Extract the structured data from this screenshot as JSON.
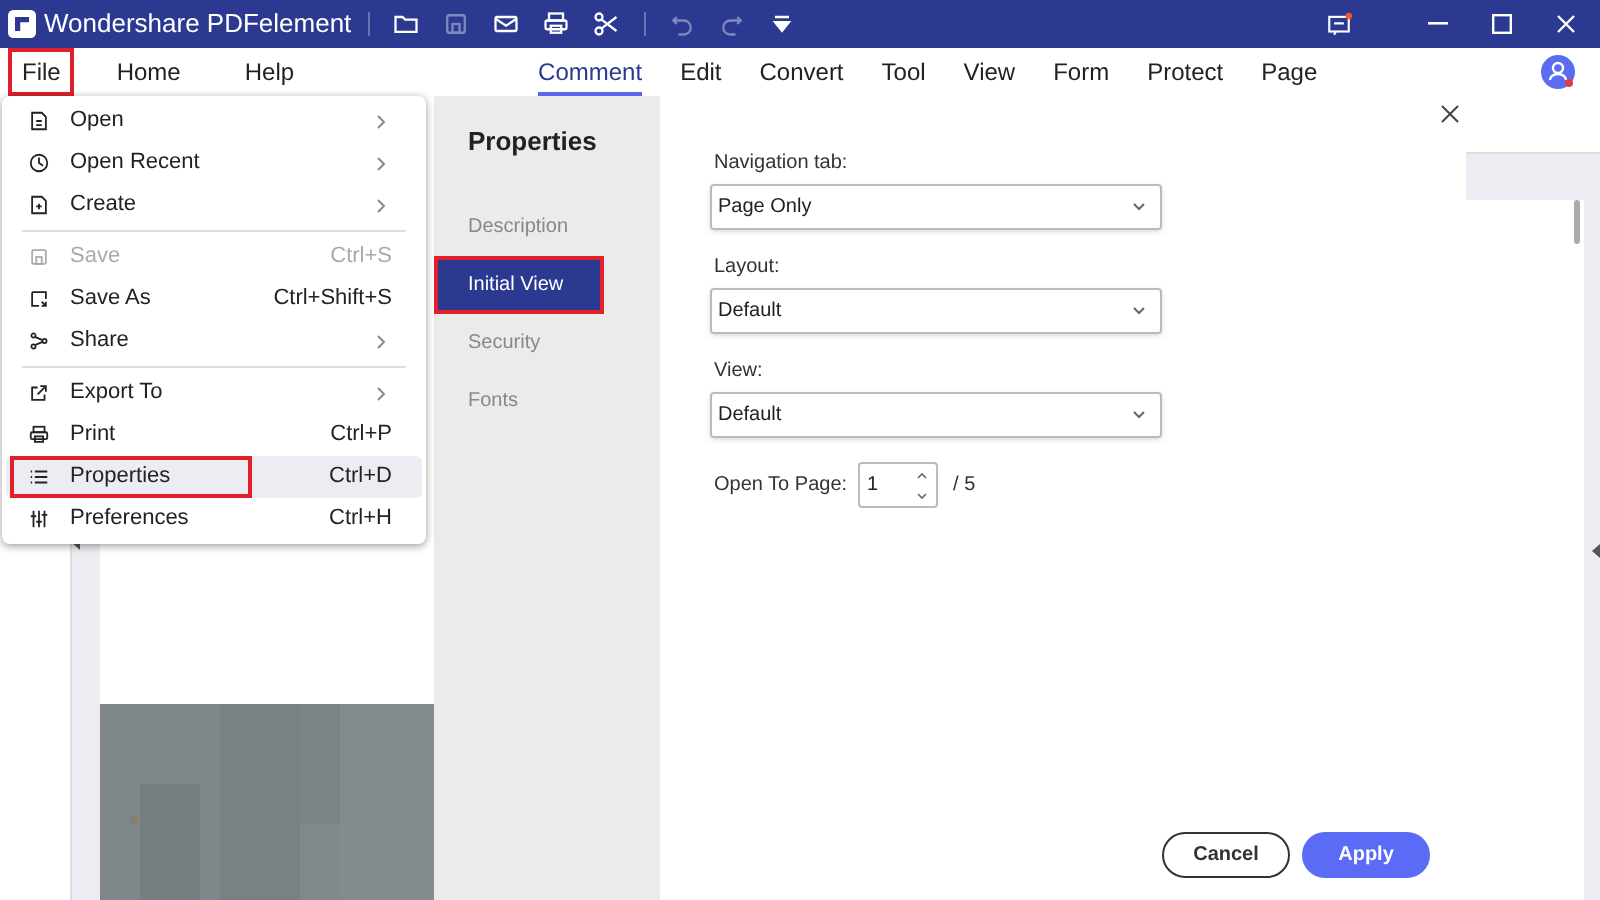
{
  "window": {
    "title": "Wondershare PDFelement"
  },
  "menu_bar": [
    {
      "label": "File",
      "outlined": true
    },
    {
      "label": "Home",
      "outlined": false
    },
    {
      "label": "Help",
      "outlined": false
    }
  ],
  "ribbon_tabs": [
    {
      "label": "Comment",
      "selected": true
    },
    {
      "label": "Edit",
      "selected": false
    },
    {
      "label": "Convert",
      "selected": false
    },
    {
      "label": "Tool",
      "selected": false
    },
    {
      "label": "View",
      "selected": false
    },
    {
      "label": "Form",
      "selected": false
    },
    {
      "label": "Protect",
      "selected": false
    },
    {
      "label": "Page",
      "selected": false
    }
  ],
  "file_menu": {
    "groups": [
      [
        {
          "label": "Open",
          "submenu": true,
          "disabled": false,
          "hovered": false,
          "outlined": false
        },
        {
          "label": "Open Recent",
          "submenu": true,
          "disabled": false,
          "hovered": false,
          "outlined": false
        },
        {
          "label": "Create",
          "submenu": true,
          "disabled": false,
          "hovered": false,
          "outlined": false
        }
      ],
      [
        {
          "label": "Save",
          "shortcut": "Ctrl+S",
          "submenu": false,
          "disabled": true,
          "hovered": false,
          "outlined": false
        },
        {
          "label": "Save As",
          "shortcut": "Ctrl+Shift+S",
          "submenu": false,
          "disabled": false,
          "hovered": false,
          "outlined": false
        },
        {
          "label": "Share",
          "submenu": true,
          "disabled": false,
          "hovered": false,
          "outlined": false
        }
      ],
      [
        {
          "label": "Export To",
          "submenu": true,
          "disabled": false,
          "hovered": false,
          "outlined": false
        },
        {
          "label": "Print",
          "shortcut": "Ctrl+P",
          "submenu": false,
          "disabled": false,
          "hovered": false,
          "outlined": false
        },
        {
          "label": "Properties",
          "shortcut": "Ctrl+D",
          "submenu": false,
          "disabled": false,
          "hovered": true,
          "outlined": true
        },
        {
          "label": "Preferences",
          "shortcut": "Ctrl+H",
          "submenu": false,
          "disabled": false,
          "hovered": false,
          "outlined": false
        }
      ]
    ]
  },
  "dialog": {
    "title": "Properties",
    "nav": [
      {
        "label": "Description",
        "selected": false,
        "outlined": false
      },
      {
        "label": "Initial View",
        "selected": true,
        "outlined": true
      },
      {
        "label": "Security",
        "selected": false,
        "outlined": false
      },
      {
        "label": "Fonts",
        "selected": false,
        "outlined": false
      }
    ],
    "fields": [
      {
        "label": "Navigation tab:",
        "value": "Page Only"
      },
      {
        "label": "Layout:",
        "value": "Default"
      },
      {
        "label": "View:",
        "value": "Default"
      }
    ],
    "open_to_page": {
      "label": "Open To Page:",
      "value": "1",
      "total": "/ 5"
    },
    "buttons": [
      {
        "label": "Cancel",
        "kind": "secondary"
      },
      {
        "label": "Apply",
        "kind": "primary"
      }
    ]
  }
}
